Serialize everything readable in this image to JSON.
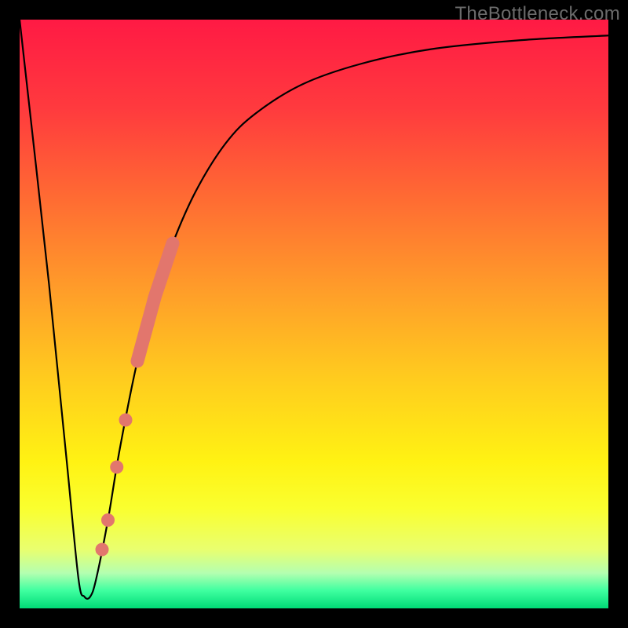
{
  "watermark": "TheBottleneck.com",
  "chart_data": {
    "type": "line",
    "title": "",
    "xlabel": "",
    "ylabel": "",
    "xlim": [
      0,
      100
    ],
    "ylim": [
      0,
      100
    ],
    "series": [
      {
        "name": "bottleneck-curve",
        "x": [
          0,
          5,
          8,
          10,
          11,
          12,
          13,
          15,
          17,
          20,
          23,
          26,
          30,
          35,
          40,
          48,
          58,
          70,
          85,
          100
        ],
        "y": [
          100,
          55,
          25,
          5,
          2,
          2,
          5,
          15,
          27,
          42,
          53,
          62,
          71,
          79,
          84,
          89,
          92.5,
          95,
          96.5,
          97.3
        ]
      }
    ],
    "highlight_segment": {
      "x_start": 20,
      "x_end": 26
    },
    "highlight_points_x": [
      14.0,
      15.0,
      16.5,
      18.0
    ],
    "colors": {
      "curve": "#000000",
      "highlight": "#e2766d",
      "gradient_top": "#ff1a44",
      "gradient_bottom": "#00db76"
    }
  }
}
